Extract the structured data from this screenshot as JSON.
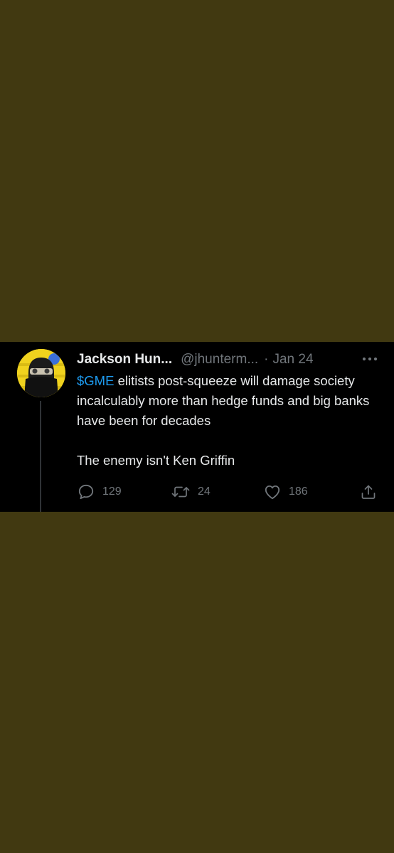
{
  "tweet": {
    "author_name": "Jackson Hun...",
    "handle": "@jhunterm...",
    "separator": "·",
    "date": "Jan 24",
    "text": {
      "cashtag": "$GME",
      "line1_rest": " elitists post-squeeze will damage society incalculably more than hedge funds and big banks have been for decades",
      "line2": "The enemy isn't Ken Griffin"
    },
    "actions": {
      "replies": "129",
      "retweets": "24",
      "likes": "186"
    },
    "icons": {
      "more": "more-icon",
      "reply": "reply-icon",
      "retweet": "retweet-icon",
      "like": "heart-icon",
      "share": "share-icon"
    }
  },
  "colors": {
    "page_background": "#413911",
    "tweet_background": "#000000",
    "text_primary": "#e7e9ea",
    "text_secondary": "#71767b",
    "link": "#1d9bf0",
    "avatar_background": "#f0d21e"
  }
}
